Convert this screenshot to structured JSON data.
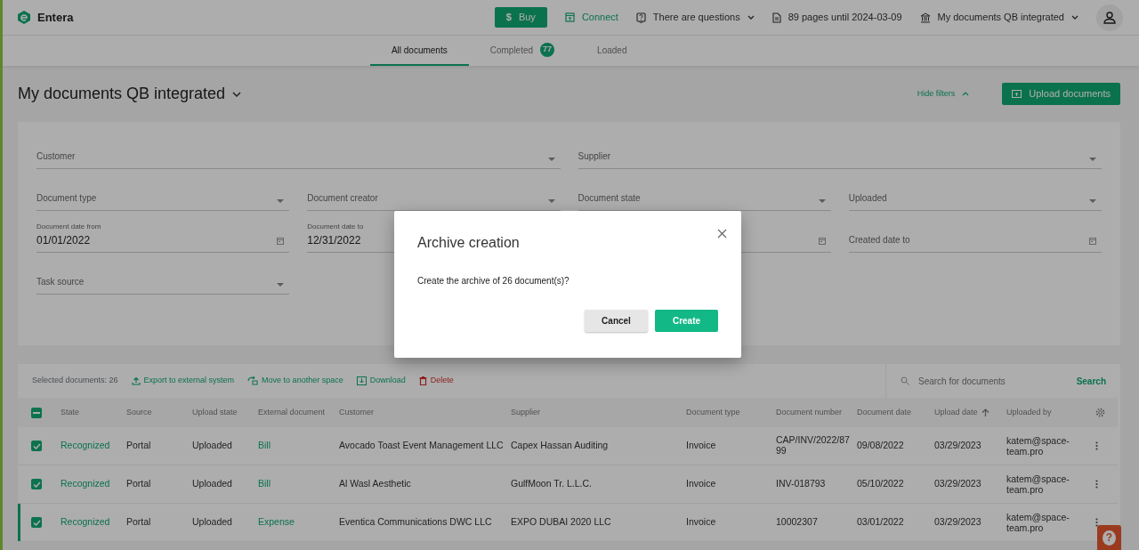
{
  "header": {
    "logo": "Entera",
    "buy": {
      "icon": "$",
      "label": "Buy"
    },
    "connect": "Connect",
    "questions": "There are questions",
    "pages": "89 pages until 2024-03-09",
    "workspace": "My documents QB integrated"
  },
  "tabs": [
    {
      "label": "All documents",
      "selected": true
    },
    {
      "label": "Completed",
      "selected": false,
      "badge": "77"
    },
    {
      "label": "Loaded",
      "selected": false
    }
  ],
  "page_title": "My documents QB integrated",
  "hide_filters": "Hide filters",
  "upload_button": "Upload documents",
  "filters": [
    [
      {
        "kind": "select",
        "label": "Customer"
      },
      {
        "kind": "select",
        "label": "Supplier"
      }
    ],
    [
      {
        "kind": "select",
        "label": "Document type"
      },
      {
        "kind": "select",
        "label": "Document creator"
      },
      {
        "kind": "select",
        "label": "Document state"
      },
      {
        "kind": "select",
        "label": "Uploaded"
      }
    ],
    [
      {
        "kind": "date",
        "label": "Document date from",
        "value": "01/01/2022",
        "calendar": true
      },
      {
        "kind": "date",
        "label": "Document date to",
        "value": "12/31/2022",
        "calendar": false
      },
      {
        "kind": "date",
        "calendar": true
      },
      {
        "kind": "date",
        "label": "Created date to",
        "calendar": true
      }
    ],
    [
      {
        "kind": "select",
        "label": "Task source"
      }
    ]
  ],
  "toolbar": {
    "selected_count": "Selected documents: 26",
    "actions": [
      {
        "kind": "export",
        "label": "Export to external system"
      },
      {
        "kind": "move",
        "label": "Move to another space"
      },
      {
        "kind": "download",
        "label": "Download"
      },
      {
        "kind": "delete",
        "label": "Delete"
      }
    ]
  },
  "search": {
    "placeholder": "Search for documents",
    "button": "Search"
  },
  "table": {
    "partly_checked": true,
    "columns": [
      {
        "label": "State",
        "kind": "link"
      },
      {
        "label": "Source"
      },
      {
        "label": "Upload state"
      },
      {
        "label": "External document",
        "kind": "link"
      },
      {
        "label": "Customer"
      },
      {
        "label": "Supplier"
      },
      {
        "label": "Document type"
      },
      {
        "label": "Document number",
        "kind": "wrap"
      },
      {
        "label": "Document date"
      },
      {
        "label": "Upload date",
        "sorted": true
      },
      {
        "label": "Uploaded by"
      }
    ],
    "rows": [
      {
        "checked": true,
        "current": false,
        "cells": [
          "Recognized",
          "Portal",
          "Uploaded",
          "Bill",
          "Avocado Toast Event Management LLC",
          "Capex Hassan Auditing",
          "Invoice",
          "CAP/INV/2022/8799",
          "09/08/2022",
          "03/29/2023",
          "katem@space-team.pro"
        ]
      },
      {
        "checked": true,
        "current": false,
        "cells": [
          "Recognized",
          "Portal",
          "Uploaded",
          "Bill",
          "Al Wasl Aesthetic",
          "GulfMoon Tr. L.L.C.",
          "Invoice",
          "INV-018793",
          "05/10/2022",
          "03/29/2023",
          "katem@space-team.pro"
        ]
      },
      {
        "checked": true,
        "current": true,
        "cells": [
          "Recognized",
          "Portal",
          "Uploaded",
          "Expense",
          "Eventica Communications DWC LLC",
          "EXPO DUBAI 2020 LLC",
          "Invoice",
          "10002307",
          "03/01/2022",
          "03/29/2023",
          "katem@space-team.pro"
        ]
      }
    ]
  },
  "help_button": "?",
  "dialog": {
    "title": "Archive creation",
    "message": "Create the archive of 26 document(s)?",
    "buttons": [
      {
        "kind": "secondary",
        "label": "Cancel"
      },
      {
        "kind": "primary",
        "label": "Create"
      }
    ]
  }
}
